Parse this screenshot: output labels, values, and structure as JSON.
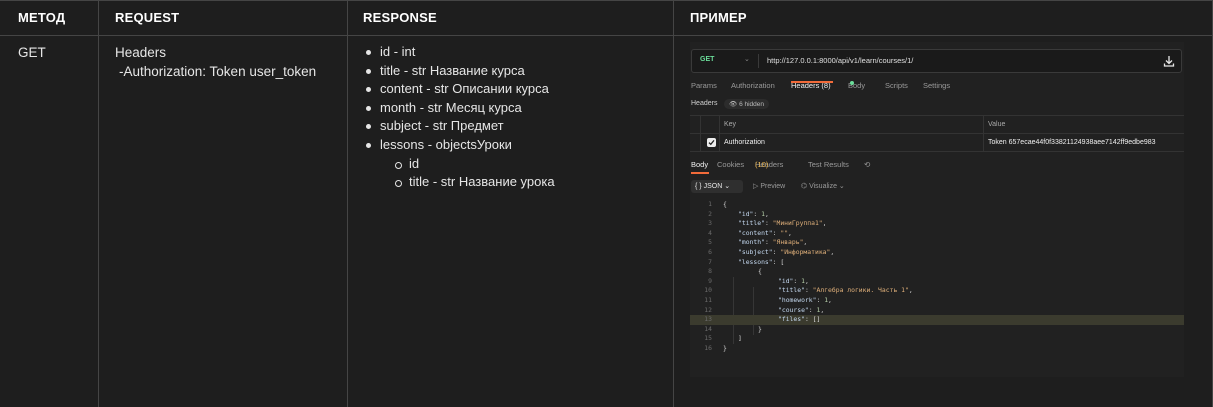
{
  "table": {
    "headers": [
      "МЕТОД",
      "REQUEST",
      "RESPONSE",
      "ПРИМЕР"
    ],
    "method": "GET",
    "request_lines": [
      "Headers",
      "-Authorization: Token user_token"
    ],
    "response_items": [
      "id - int",
      "title -  str Название курса",
      "content - str Описании курса",
      "month  - str Месяц курса",
      "subject - str Предмет",
      "lessons - objectsУроки"
    ],
    "response_subitems": [
      "id",
      "title - str Название урока"
    ]
  },
  "postman": {
    "method": "GET",
    "url": "http://127.0.0.1:8000/api/v1/learn/courses/1/",
    "request_tabs": [
      "Params",
      "Authorization",
      "Headers (8)",
      "Body",
      "Scripts",
      "Settings"
    ],
    "headers_label": "Headers",
    "hidden_badge": "6 hidden",
    "col_key": "Key",
    "col_value": "Value",
    "header_key": "Authorization",
    "header_value": "Token 657ecae44f0f33821124938aee7142ff9edbe983",
    "response_tabs": {
      "body": "Body",
      "cookies": "Cookies",
      "headers": "Headers",
      "headers_count": "(10)",
      "test_results": "Test Results"
    },
    "format": "JSON",
    "preview": "Preview",
    "visualize": "Visualize",
    "line_numbers": [
      "1",
      "2",
      "3",
      "4",
      "5",
      "6",
      "7",
      "8",
      "9",
      "10",
      "11",
      "12",
      "13",
      "14",
      "15",
      "16"
    ],
    "code": {
      "open_brace": "{",
      "close_brace": "}",
      "id_key": "\"id\"",
      "id_val": "1",
      "title_key": "\"title\"",
      "title_val": "\"МиниГруппа1\"",
      "content_key": "\"content\"",
      "content_val": "\"\"",
      "month_key": "\"month\"",
      "month_val": "\"Январь\"",
      "subject_key": "\"subject\"",
      "subject_val": "\"Информатика\"",
      "lessons_key": "\"lessons\"",
      "open_bracket": "[",
      "close_bracket": "]",
      "l_id_key": "\"id\"",
      "l_id_val": "1",
      "l_title_key": "\"title\"",
      "l_title_val": "\"Алгебра логики. Часть 1\"",
      "l_homework_key": "\"homework\"",
      "l_homework_val": "1",
      "l_course_key": "\"course\"",
      "l_course_val": "1",
      "l_files_key": "\"files\"",
      "l_files_val": "[]"
    }
  }
}
